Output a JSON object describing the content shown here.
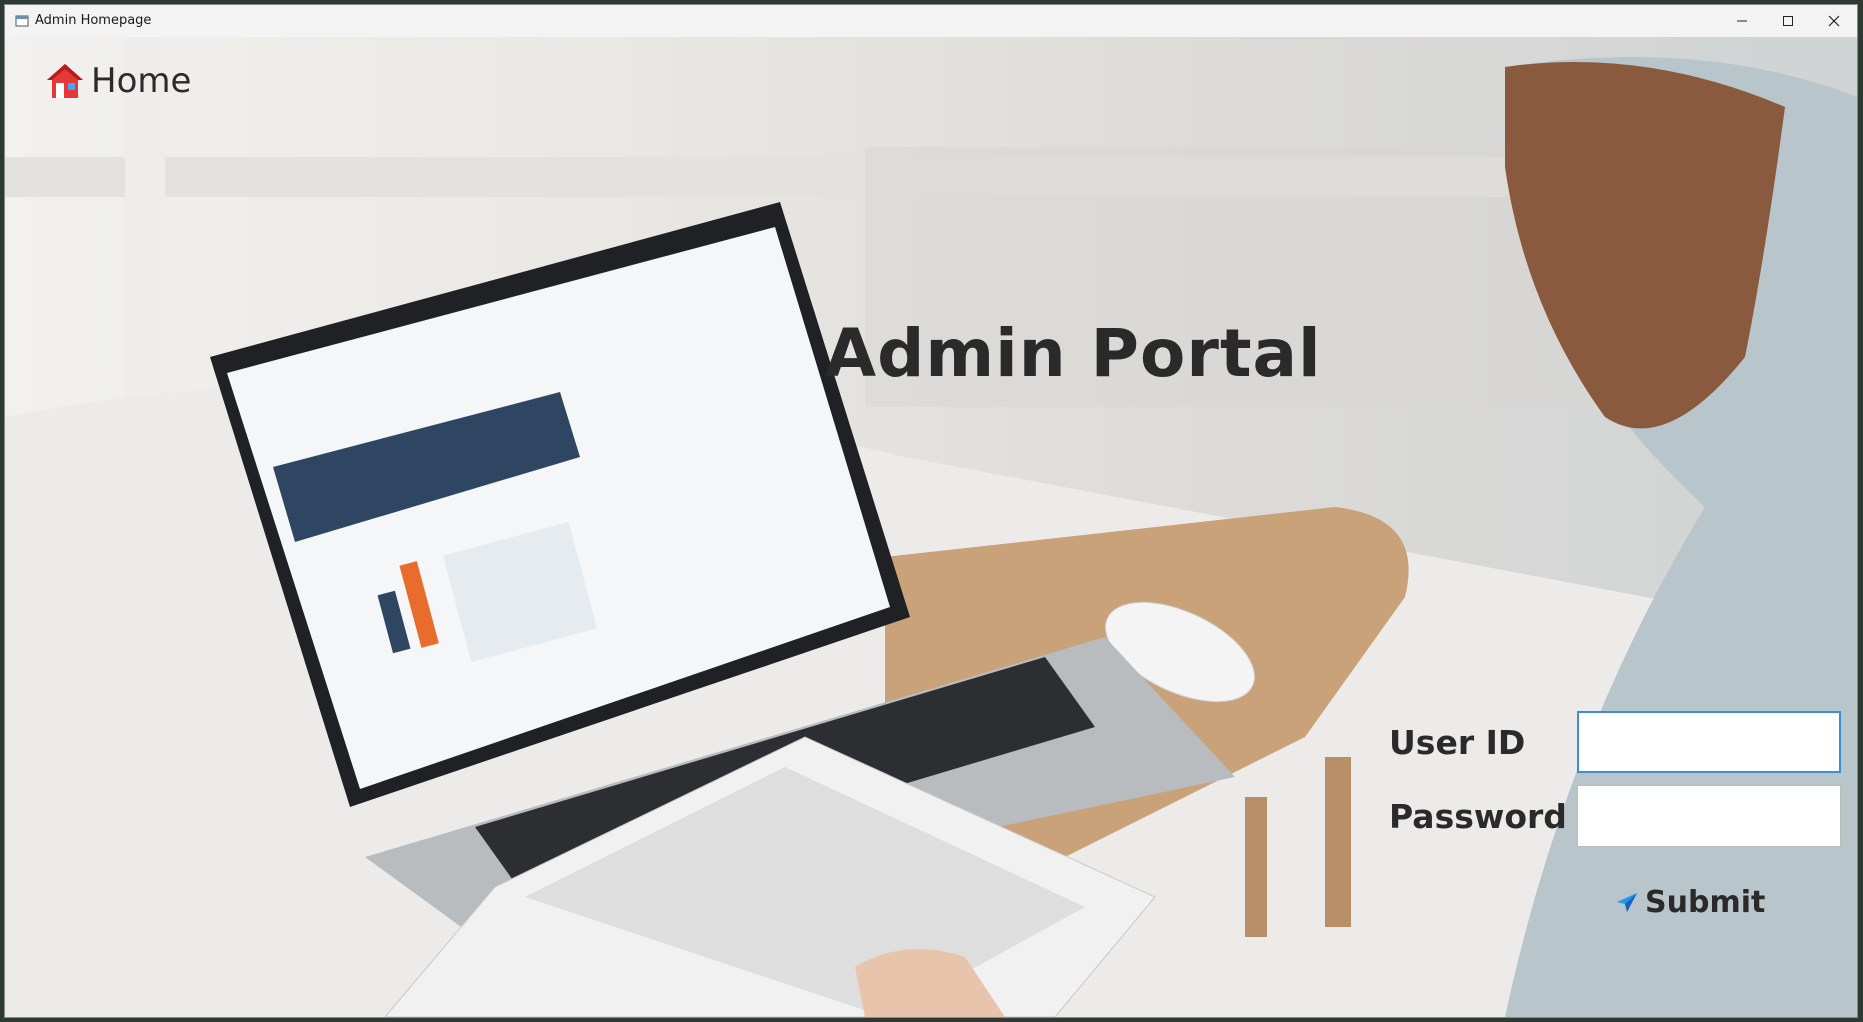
{
  "window": {
    "title": "Admin Homepage"
  },
  "header": {
    "home_label": "Home"
  },
  "main": {
    "title": "Admin Portal",
    "form": {
      "user_id_label": "User ID",
      "user_id_value": "",
      "password_label": "Password",
      "password_value": "",
      "submit_label": "Submit"
    }
  },
  "colors": {
    "accent": "#3b8fd9",
    "text": "#2a2a2a"
  },
  "icons": {
    "home": "home-icon",
    "submit": "send-icon"
  }
}
